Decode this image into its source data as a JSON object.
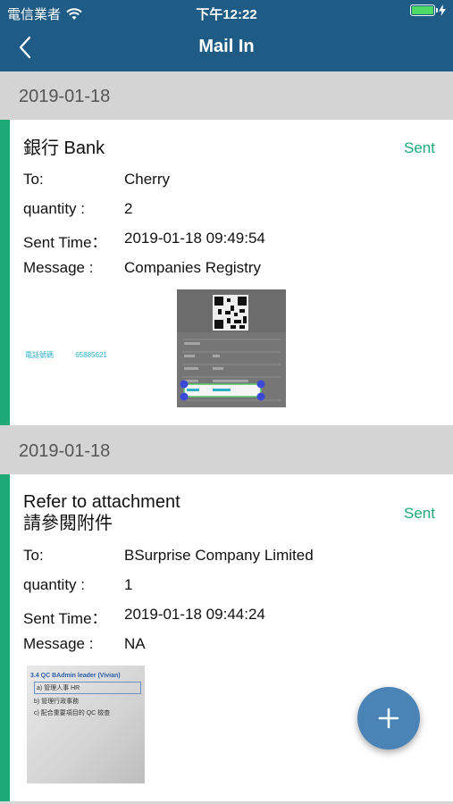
{
  "status_bar": {
    "carrier": "電信業者",
    "time": "下午12:22"
  },
  "nav": {
    "title": "Mail In"
  },
  "entries": [
    {
      "date": "2019-01-18",
      "title_line1": "銀行 Bank",
      "title_line2": "",
      "status": "Sent",
      "to_label": "To:",
      "to": "Cherry",
      "quantity_label": "quantity :",
      "quantity": "2",
      "sent_time_label": "Sent Time：",
      "sent_time": "2019-01-18 09:49:54",
      "message_label": "Message :",
      "message": "Companies Registry",
      "attachment_text": {
        "phone_label": "電話號碼",
        "phone": "65885621"
      }
    },
    {
      "date": "2019-01-18",
      "title_line1": "Refer to attachment",
      "title_line2": "請參閱附件",
      "status": "Sent",
      "to_label": "To:",
      "to": "BSurprise Company Limited",
      "quantity_label": "quantity :",
      "quantity": "1",
      "sent_time_label": "Sent Time：",
      "sent_time": "2019-01-18 09:44:24",
      "message_label": "Message :",
      "message": "NA",
      "attachment_text": {
        "heading": "3.4 QC BAdmin leader (Vivian)",
        "items": [
          "a)  管理人事 HR",
          "b)  管理行政事務",
          "c)  配合重要項目的 QC 檢查"
        ]
      }
    }
  ],
  "icons": {
    "back": "chevron-left-icon",
    "add": "plus-icon",
    "wifi": "wifi-icon",
    "battery": "battery-icon",
    "charging": "bolt-icon"
  },
  "colors": {
    "nav": "#1e5b85",
    "accent": "#1daa76",
    "fab": "#4a84b6"
  }
}
